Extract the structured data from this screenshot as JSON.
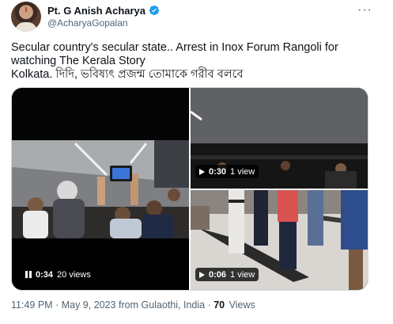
{
  "author": {
    "display_name": "Pt. G Anish Acharya",
    "handle": "@AcharyaGopalan",
    "verified": true
  },
  "tweet": {
    "lines": [
      "Secular country's secular state.. Arrest in Inox Forum Rangoli for",
      "watching The Kerala Story",
      "Kolkata. দিদি, ভবিষ্যৎ প্রজন্ম তোমাকে গরীব বলবে"
    ]
  },
  "media": [
    {
      "icon": "pause-icon",
      "duration": "0:34",
      "views": "20 views"
    },
    {
      "icon": "play-icon",
      "duration": "0:30",
      "views": "1 view"
    },
    {
      "icon": "play-icon",
      "duration": "0:06",
      "views": "1 view"
    }
  ],
  "footer": {
    "time": "11:49 PM",
    "date": "May 9, 2023",
    "source": "from Gulaothi, India",
    "views_count": "70",
    "views_label": "Views",
    "sep": "·"
  },
  "colors": {
    "text_primary": "#0f1419",
    "text_secondary": "#536471",
    "verified_blue": "#1d9bf0",
    "border": "#cfd9de"
  }
}
